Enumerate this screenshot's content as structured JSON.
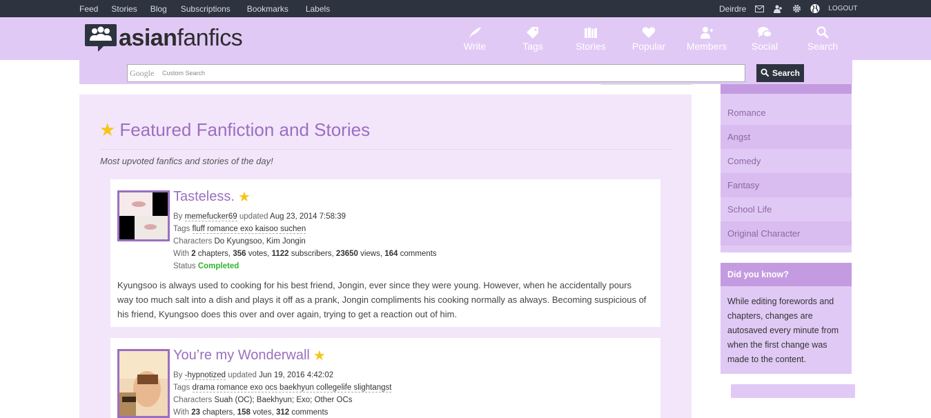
{
  "topbar": {
    "links": [
      "Feed",
      "Stories",
      "Blog",
      "Subscriptions",
      "Bookmarks",
      "Labels"
    ],
    "username": "Deirdre",
    "logout": "LOGOUT"
  },
  "header": {
    "logo_bold": "asian",
    "logo_light": "fanfics",
    "nav": [
      {
        "label": "Write",
        "icon": "quill-icon"
      },
      {
        "label": "Tags",
        "icon": "tag-icon"
      },
      {
        "label": "Stories",
        "icon": "books-icon"
      },
      {
        "label": "Popular",
        "icon": "heart-icon"
      },
      {
        "label": "Members",
        "icon": "members-icon"
      },
      {
        "label": "Social",
        "icon": "chat-icon"
      },
      {
        "label": "Search",
        "icon": "search-icon"
      }
    ]
  },
  "search": {
    "brand": "Google",
    "placeholder": "Custom Search",
    "button": "Search"
  },
  "featured": {
    "title": "Featured Fanfiction and Stories",
    "subtitle": "Most upvoted fanfics and stories of the day!"
  },
  "stories": [
    {
      "title": "Tasteless.",
      "by_label": "By",
      "author": "memefucker69",
      "updated_label": "updated",
      "updated": "Aug 23, 2014 7:58:39",
      "tags_label": "Tags",
      "tags": "fluff romance exo kaisoo suchen",
      "characters_label": "Characters",
      "characters": "Do Kyungsoo, Kim Jongin",
      "with_label": "With",
      "chapters": "2",
      "votes": "356",
      "subscribers": "1122",
      "views": "23650",
      "comments": "164",
      "status_label": "Status",
      "status": "Completed",
      "description": "Kyungsoo is always used to cooking for his best friend, Jongin, ever since they were young. However, when he accidentally pours way too much salt into a dish and plays it off as a prank, Jongin compliments his cooking normally as always. Becoming suspicious of his friend, Kyungsoo does this over and over again, trying to get a reaction out of him."
    },
    {
      "title": "You’re my Wonderwall",
      "by_label": "By",
      "author": "-hypnotized",
      "updated_label": "updated",
      "updated": "Jun 19, 2016 4:42:02",
      "tags_label": "Tags",
      "tags": "drama romance exo ocs baekhyun collegelife slightangst",
      "characters_label": "Characters",
      "characters": "Suah (OC); Baekhyun; Exo; Other OCs",
      "with_label": "With",
      "chapters": "23",
      "votes": "158",
      "comments": "312"
    }
  ],
  "sidebar": {
    "tags": [
      "Romance",
      "Angst",
      "Comedy",
      "Fantasy",
      "School Life",
      "Original Character"
    ],
    "dyk_title": "Did you know?",
    "dyk_text": "While editing forewords and chapters, changes are autosaved every minute from when the first change was made to the content."
  },
  "colors": {
    "topbar": "#2d3440",
    "header": "#e1c9f5",
    "accent": "#9b6fc0",
    "status_completed": "#2fb52f"
  }
}
